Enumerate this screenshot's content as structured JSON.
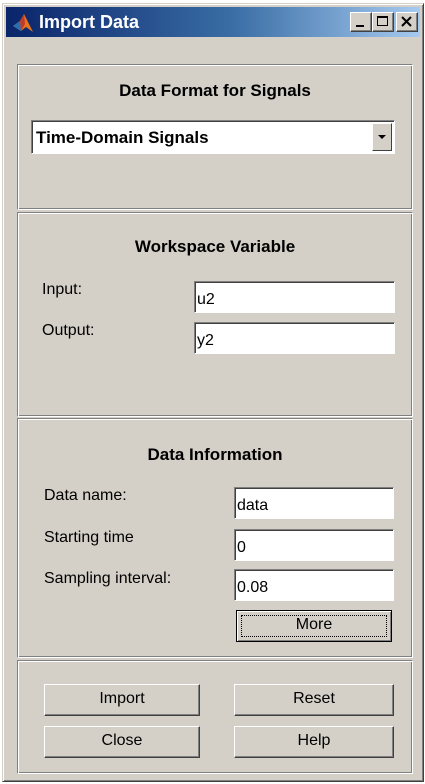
{
  "window": {
    "title": "Import Data",
    "controls": {
      "minimize": "minimize-icon",
      "maximize": "maximize-icon",
      "close": "close-icon"
    }
  },
  "data_format": {
    "heading": "Data Format for Signals",
    "selected": "Time-Domain Signals"
  },
  "workspace": {
    "heading": "Workspace Variable",
    "input_label": "Input:",
    "input_value": "u2",
    "output_label": "Output:",
    "output_value": "y2"
  },
  "data_info": {
    "heading": "Data Information",
    "name_label": "Data name:",
    "name_value": "data",
    "start_label": "Starting time",
    "start_value": "0",
    "interval_label": "Sampling interval:",
    "interval_value": "0.08",
    "more_label": "More"
  },
  "actions": {
    "import_label": "Import",
    "reset_label": "Reset",
    "close_label": "Close",
    "help_label": "Help"
  },
  "colors": {
    "face": "#d4d0c8",
    "title_start": "#0a246a",
    "title_end": "#a6caf0"
  }
}
